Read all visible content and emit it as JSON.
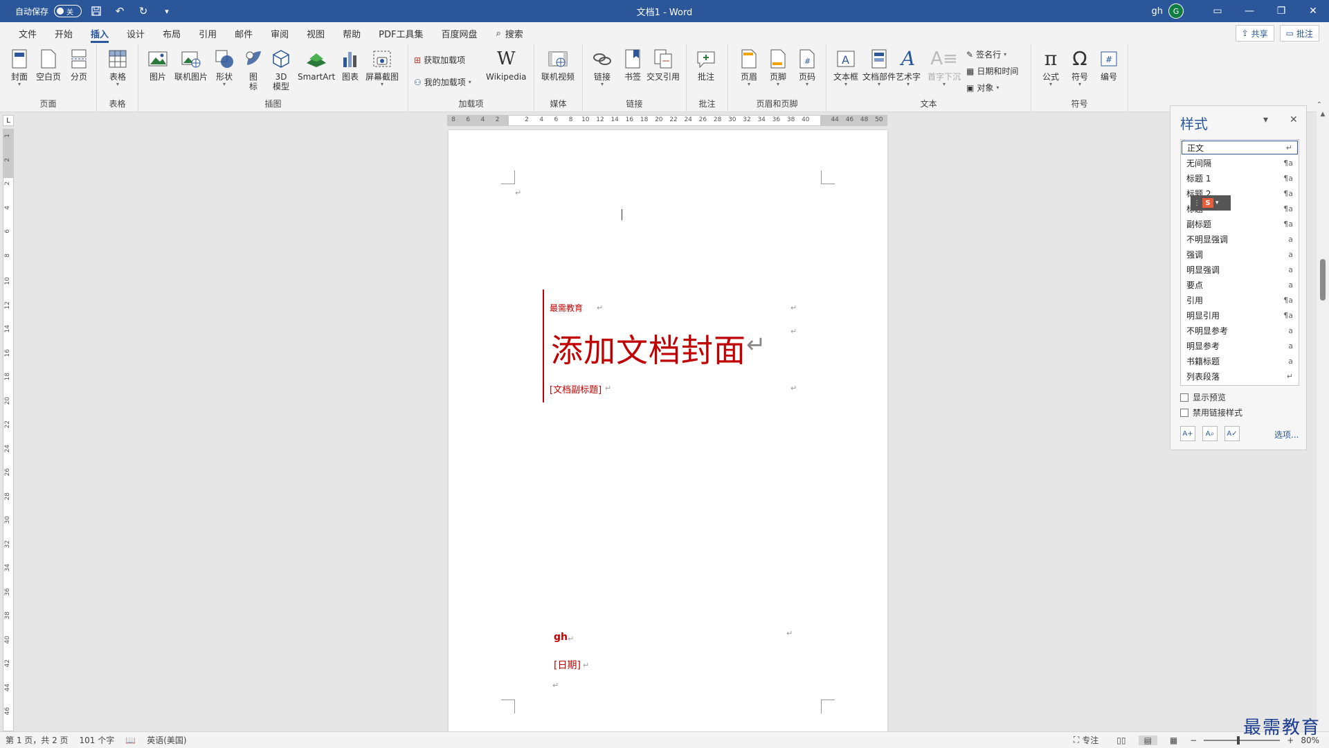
{
  "titlebar": {
    "autosave_label": "自动保存",
    "autosave_state": "关",
    "doc_title": "文档1 - Word",
    "user": "gh",
    "avatar_letter": "G"
  },
  "menu": {
    "tabs": [
      "文件",
      "开始",
      "插入",
      "设计",
      "布局",
      "引用",
      "邮件",
      "审阅",
      "视图",
      "帮助",
      "PDF工具集",
      "百度网盘"
    ],
    "active_tab": "插入",
    "search_label": "搜索",
    "share_label": "共享",
    "comment_label": "批注"
  },
  "ribbon": {
    "pages": {
      "label": "页面",
      "cover": "封面",
      "blank": "空白页",
      "break": "分页"
    },
    "tables": {
      "label": "表格",
      "table": "表格"
    },
    "illustrations": {
      "label": "插图",
      "pictures": "图片",
      "online_pictures": "联机图片",
      "shapes": "形状",
      "icons_a": "图",
      "icons_b": "标",
      "model_a": "3D",
      "model_b": "模型",
      "smartart": "SmartArt",
      "chart": "图表",
      "screenshot": "屏幕截图"
    },
    "addins": {
      "label": "加载项",
      "get": "获取加载项",
      "my": "我的加载项",
      "wikipedia": "Wikipedia"
    },
    "media": {
      "label": "媒体",
      "video": "联机视频"
    },
    "links": {
      "label": "链接",
      "link": "链接",
      "bookmark": "书签",
      "crossref": "交叉引用"
    },
    "comments": {
      "label": "批注",
      "comment": "批注"
    },
    "header_footer": {
      "label": "页眉和页脚",
      "header": "页眉",
      "footer": "页脚",
      "page_number": "页码"
    },
    "text": {
      "label": "文本",
      "textbox": "文本框",
      "quick_parts": "文档部件",
      "wordart": "艺术字",
      "dropcap": "首字下沉",
      "signature": "签名行",
      "datetime": "日期和时间",
      "object": "对象"
    },
    "symbols": {
      "label": "符号",
      "equation": "公式",
      "symbol": "符号",
      "numbering": "编号"
    }
  },
  "ruler": {
    "h_ticks": [
      "8",
      "6",
      "4",
      "2",
      "",
      "2",
      "4",
      "6",
      "8",
      "10",
      "12",
      "14",
      "16",
      "18",
      "20",
      "22",
      "24",
      "26",
      "28",
      "30",
      "32",
      "34",
      "36",
      "38",
      "40",
      "",
      "44",
      "46",
      "48",
      "50"
    ],
    "v_ticks": [
      "1",
      "2",
      "2",
      "4",
      "6",
      "8",
      "10",
      "12",
      "14",
      "16",
      "18",
      "20",
      "22",
      "24",
      "26",
      "28",
      "30",
      "32",
      "34",
      "36",
      "38",
      "40",
      "42",
      "44",
      "46"
    ],
    "corner": "L"
  },
  "document": {
    "company": "最需教育",
    "title": "添加文档封面",
    "subtitle": "[文档副标题]",
    "author": "gh",
    "date": "[日期]"
  },
  "styles_pane": {
    "title": "样式",
    "items": [
      {
        "name": "正文",
        "mark": "↵"
      },
      {
        "name": "无间隔",
        "mark": "¶a"
      },
      {
        "name": "标题 1",
        "mark": "¶a"
      },
      {
        "name": "标题 2",
        "mark": "¶a"
      },
      {
        "name": "标题",
        "mark": "¶a"
      },
      {
        "name": "副标题",
        "mark": "¶a"
      },
      {
        "name": "不明显强调",
        "mark": "a"
      },
      {
        "name": "强调",
        "mark": "a"
      },
      {
        "name": "明显强调",
        "mark": "a"
      },
      {
        "name": "要点",
        "mark": "a"
      },
      {
        "name": "引用",
        "mark": "¶a"
      },
      {
        "name": "明显引用",
        "mark": "¶a"
      },
      {
        "name": "不明显参考",
        "mark": "a"
      },
      {
        "name": "明显参考",
        "mark": "a"
      },
      {
        "name": "书籍标题",
        "mark": "a"
      },
      {
        "name": "列表段落",
        "mark": "↵"
      }
    ],
    "show_preview": "显示预览",
    "disable_linked": "禁用链接样式",
    "options": "选项..."
  },
  "statusbar": {
    "page": "第 1 页，共 2 页",
    "words": "101 个字",
    "language": "英语(美国)",
    "focus": "专注",
    "zoom": "80%"
  },
  "watermark": "最需教育"
}
